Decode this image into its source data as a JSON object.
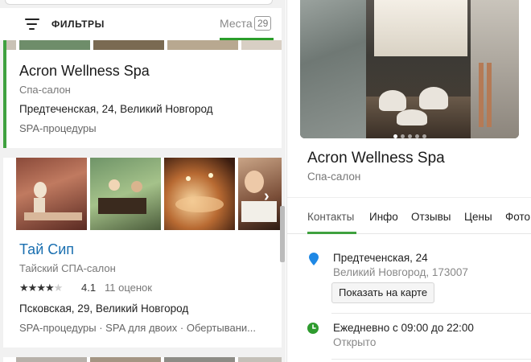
{
  "filters": {
    "label": "ФИЛЬТРЫ"
  },
  "places_tab": {
    "label": "Места",
    "count": "29"
  },
  "results": [
    {
      "title": "Acron Wellness Spa",
      "category": "Спа-салон",
      "address": "Предтеченская, 24, Великий Новгород",
      "tags": "SPA-процедуры"
    },
    {
      "title": "Тай Сип",
      "category": "Тайский СПА-салон",
      "rating": "4.1",
      "reviews": "11 оценок",
      "stars_filled": 4,
      "stars_total": 5,
      "address": "Псковская, 29, Великий Новгород",
      "tags": "SPA-процедуры · SPA для двоих · Обертывани..."
    }
  ],
  "details": {
    "title": "Acron Wellness Spa",
    "category": "Спа-салон",
    "tabs": [
      "Контакты",
      "Инфо",
      "Отзывы",
      "Цены",
      "Фото"
    ],
    "active_tab": "Контакты",
    "address_line1": "Предтеченская, 24",
    "address_line2": "Великий Новгород, 173007",
    "show_on_map": "Показать на карте",
    "hours": "Ежедневно с 09:00 до 22:00",
    "status": "Открыто"
  },
  "colors": {
    "accent": "#3fa13f",
    "link": "#1a6fb0",
    "pin": "#1e88e5",
    "clock": "#2e9b2e"
  },
  "icons": {
    "filter": "filter-icon",
    "pin": "map-pin-icon",
    "clock": "clock-icon",
    "next": "chevron-right-icon",
    "star": "star-icon"
  }
}
